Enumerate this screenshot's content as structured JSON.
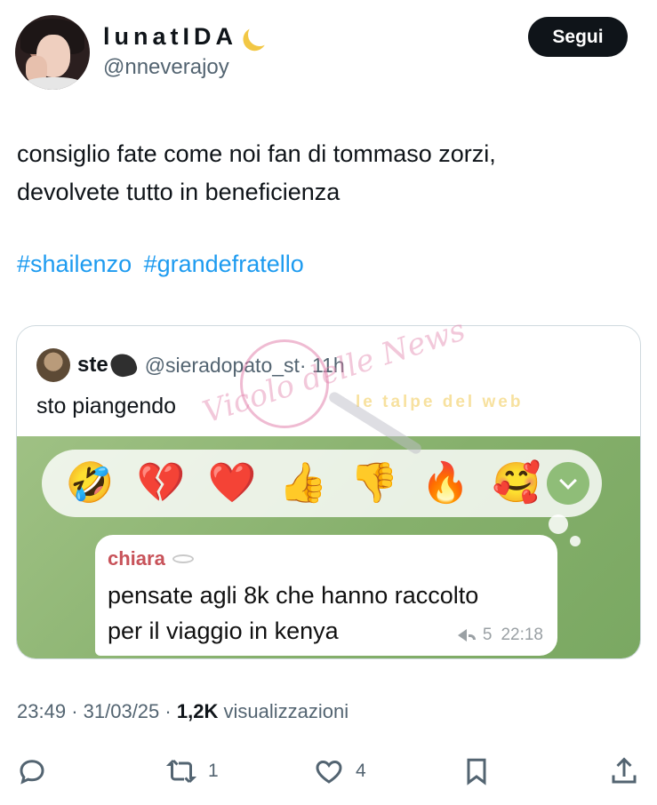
{
  "author": {
    "display_name": "lunatIDA",
    "handle": "@nneverajoy",
    "follow_label": "Segui"
  },
  "tweet": {
    "text_line1": "consiglio fate come noi fan di tommaso zorzi,",
    "text_line2": "devolvete tutto in beneficienza",
    "hashtags": [
      "#shailenzo",
      "#grandefratello"
    ]
  },
  "quoted": {
    "name": "ste",
    "handle": "@sieradopato_st",
    "time": "· 11h",
    "text": "sto piangendo",
    "reactions": [
      "🤣",
      "💔",
      "❤️",
      "👍",
      "👎",
      "🔥",
      "🥰"
    ],
    "message": {
      "sender": "chiara",
      "line1": "pensate agli 8k che hanno raccolto",
      "line2": "per il viaggio in kenya",
      "reply_count": "5",
      "time": "22:18"
    },
    "watermark": {
      "script": "Vicolo delle News",
      "banner": "le talpe del web"
    }
  },
  "meta": {
    "time": "23:49",
    "date": "31/03/25",
    "views": "1,2K",
    "views_label": "visualizzazioni"
  },
  "actions": {
    "retweets": "1",
    "likes": "4"
  },
  "colors": {
    "link": "#1d9bf0",
    "text": "#0f1419",
    "muted": "#536471",
    "chat_green": "#86b06c",
    "sender_red": "#c8535a"
  }
}
